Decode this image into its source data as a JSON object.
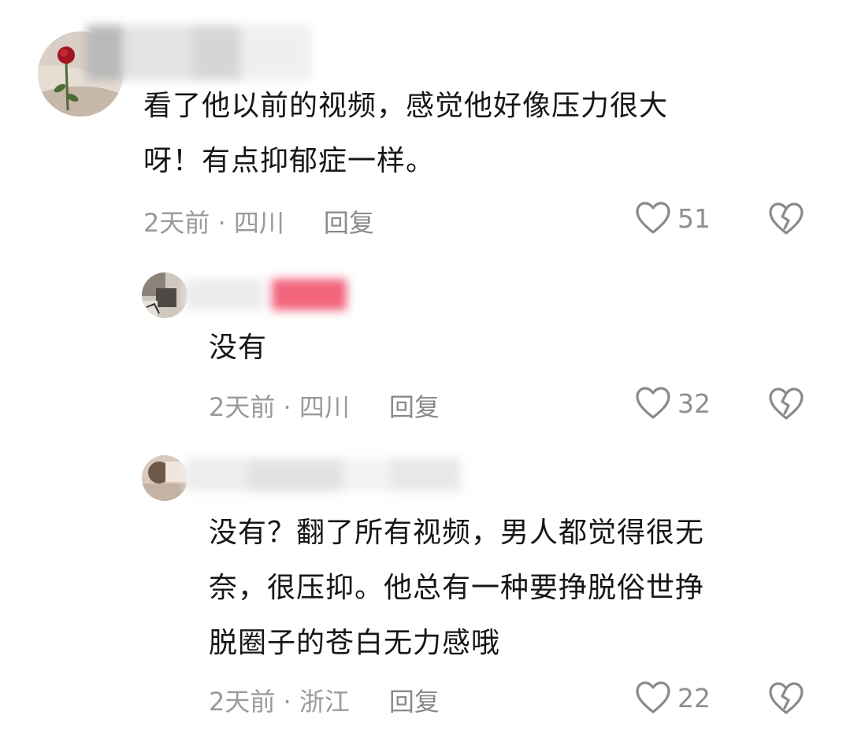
{
  "comments": [
    {
      "text_lines": [
        "看了他以前的视频，感觉他好像压力很大",
        "呀！有点抑郁症一样。"
      ],
      "time": "2天前 · 四川",
      "reply_label": "回复",
      "likes": "51",
      "avatar_icon": "rose-avatar"
    },
    {
      "text_lines": [
        "没有"
      ],
      "time": "2天前 · 四川",
      "reply_label": "回复",
      "likes": "32",
      "avatar_icon": "user-avatar"
    },
    {
      "text_lines": [
        "没有？翻了所有视频，男人都觉得很无",
        "奈，很压抑。他总有一种要挣脱俗世挣",
        "脱圈子的苍白无力感哦"
      ],
      "time": "2天前 · 浙江",
      "reply_label": "回复",
      "likes": "22",
      "avatar_icon": "user-avatar"
    }
  ],
  "icons": {
    "like": "heart-outline-icon",
    "dislike": "broken-heart-icon"
  },
  "colors": {
    "text": "#161616",
    "meta": "#9a9a9a",
    "icon": "#8a8a8a",
    "name_highlight": "#f0637a"
  }
}
